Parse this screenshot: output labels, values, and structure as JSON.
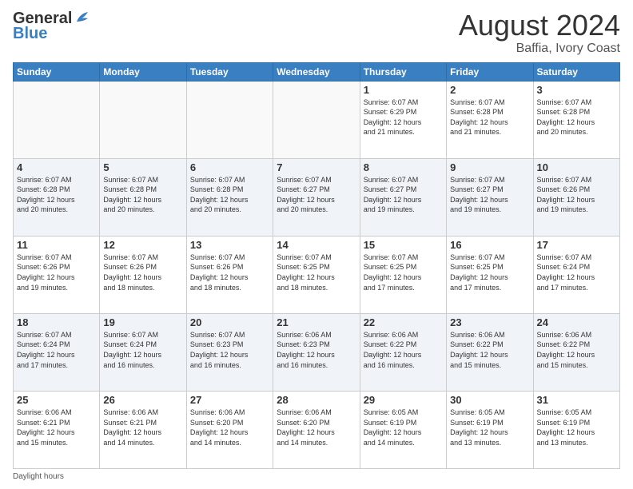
{
  "logo": {
    "line1": "General",
    "line2": "Blue"
  },
  "title": "August 2024",
  "subtitle": "Baffia, Ivory Coast",
  "header_days": [
    "Sunday",
    "Monday",
    "Tuesday",
    "Wednesday",
    "Thursday",
    "Friday",
    "Saturday"
  ],
  "footer": "Daylight hours",
  "weeks": [
    [
      {
        "day": "",
        "detail": ""
      },
      {
        "day": "",
        "detail": ""
      },
      {
        "day": "",
        "detail": ""
      },
      {
        "day": "",
        "detail": ""
      },
      {
        "day": "1",
        "detail": "Sunrise: 6:07 AM\nSunset: 6:29 PM\nDaylight: 12 hours\nand 21 minutes."
      },
      {
        "day": "2",
        "detail": "Sunrise: 6:07 AM\nSunset: 6:28 PM\nDaylight: 12 hours\nand 21 minutes."
      },
      {
        "day": "3",
        "detail": "Sunrise: 6:07 AM\nSunset: 6:28 PM\nDaylight: 12 hours\nand 20 minutes."
      }
    ],
    [
      {
        "day": "4",
        "detail": "Sunrise: 6:07 AM\nSunset: 6:28 PM\nDaylight: 12 hours\nand 20 minutes."
      },
      {
        "day": "5",
        "detail": "Sunrise: 6:07 AM\nSunset: 6:28 PM\nDaylight: 12 hours\nand 20 minutes."
      },
      {
        "day": "6",
        "detail": "Sunrise: 6:07 AM\nSunset: 6:28 PM\nDaylight: 12 hours\nand 20 minutes."
      },
      {
        "day": "7",
        "detail": "Sunrise: 6:07 AM\nSunset: 6:27 PM\nDaylight: 12 hours\nand 20 minutes."
      },
      {
        "day": "8",
        "detail": "Sunrise: 6:07 AM\nSunset: 6:27 PM\nDaylight: 12 hours\nand 19 minutes."
      },
      {
        "day": "9",
        "detail": "Sunrise: 6:07 AM\nSunset: 6:27 PM\nDaylight: 12 hours\nand 19 minutes."
      },
      {
        "day": "10",
        "detail": "Sunrise: 6:07 AM\nSunset: 6:26 PM\nDaylight: 12 hours\nand 19 minutes."
      }
    ],
    [
      {
        "day": "11",
        "detail": "Sunrise: 6:07 AM\nSunset: 6:26 PM\nDaylight: 12 hours\nand 19 minutes."
      },
      {
        "day": "12",
        "detail": "Sunrise: 6:07 AM\nSunset: 6:26 PM\nDaylight: 12 hours\nand 18 minutes."
      },
      {
        "day": "13",
        "detail": "Sunrise: 6:07 AM\nSunset: 6:26 PM\nDaylight: 12 hours\nand 18 minutes."
      },
      {
        "day": "14",
        "detail": "Sunrise: 6:07 AM\nSunset: 6:25 PM\nDaylight: 12 hours\nand 18 minutes."
      },
      {
        "day": "15",
        "detail": "Sunrise: 6:07 AM\nSunset: 6:25 PM\nDaylight: 12 hours\nand 17 minutes."
      },
      {
        "day": "16",
        "detail": "Sunrise: 6:07 AM\nSunset: 6:25 PM\nDaylight: 12 hours\nand 17 minutes."
      },
      {
        "day": "17",
        "detail": "Sunrise: 6:07 AM\nSunset: 6:24 PM\nDaylight: 12 hours\nand 17 minutes."
      }
    ],
    [
      {
        "day": "18",
        "detail": "Sunrise: 6:07 AM\nSunset: 6:24 PM\nDaylight: 12 hours\nand 17 minutes."
      },
      {
        "day": "19",
        "detail": "Sunrise: 6:07 AM\nSunset: 6:24 PM\nDaylight: 12 hours\nand 16 minutes."
      },
      {
        "day": "20",
        "detail": "Sunrise: 6:07 AM\nSunset: 6:23 PM\nDaylight: 12 hours\nand 16 minutes."
      },
      {
        "day": "21",
        "detail": "Sunrise: 6:06 AM\nSunset: 6:23 PM\nDaylight: 12 hours\nand 16 minutes."
      },
      {
        "day": "22",
        "detail": "Sunrise: 6:06 AM\nSunset: 6:22 PM\nDaylight: 12 hours\nand 16 minutes."
      },
      {
        "day": "23",
        "detail": "Sunrise: 6:06 AM\nSunset: 6:22 PM\nDaylight: 12 hours\nand 15 minutes."
      },
      {
        "day": "24",
        "detail": "Sunrise: 6:06 AM\nSunset: 6:22 PM\nDaylight: 12 hours\nand 15 minutes."
      }
    ],
    [
      {
        "day": "25",
        "detail": "Sunrise: 6:06 AM\nSunset: 6:21 PM\nDaylight: 12 hours\nand 15 minutes."
      },
      {
        "day": "26",
        "detail": "Sunrise: 6:06 AM\nSunset: 6:21 PM\nDaylight: 12 hours\nand 14 minutes."
      },
      {
        "day": "27",
        "detail": "Sunrise: 6:06 AM\nSunset: 6:20 PM\nDaylight: 12 hours\nand 14 minutes."
      },
      {
        "day": "28",
        "detail": "Sunrise: 6:06 AM\nSunset: 6:20 PM\nDaylight: 12 hours\nand 14 minutes."
      },
      {
        "day": "29",
        "detail": "Sunrise: 6:05 AM\nSunset: 6:19 PM\nDaylight: 12 hours\nand 14 minutes."
      },
      {
        "day": "30",
        "detail": "Sunrise: 6:05 AM\nSunset: 6:19 PM\nDaylight: 12 hours\nand 13 minutes."
      },
      {
        "day": "31",
        "detail": "Sunrise: 6:05 AM\nSunset: 6:19 PM\nDaylight: 12 hours\nand 13 minutes."
      }
    ]
  ]
}
